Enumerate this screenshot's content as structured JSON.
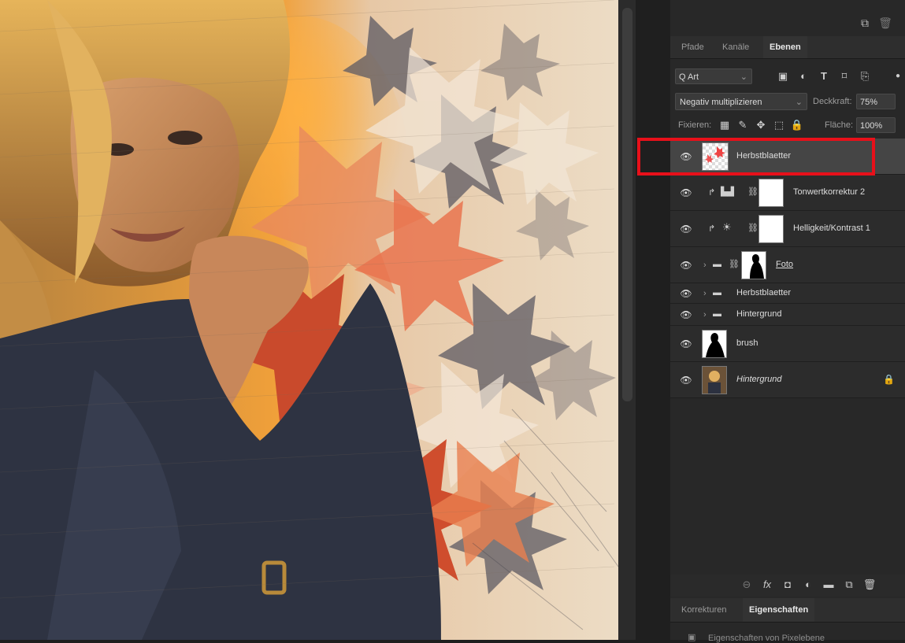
{
  "panel": {
    "tabs": [
      {
        "label": "Pfade",
        "active": false
      },
      {
        "label": "Kanäle",
        "active": false
      },
      {
        "label": "Ebenen",
        "active": true
      }
    ],
    "filter": {
      "search_label": "Q Art",
      "icons": [
        "image-filter-icon",
        "adjustment-filter-icon",
        "type-filter-icon",
        "shape-filter-icon",
        "smart-object-filter-icon"
      ]
    },
    "blend_mode": "Negativ multiplizieren",
    "opacity_label": "Deckkraft:",
    "opacity_value": "75%",
    "lock_label": "Fixieren:",
    "fill_label": "Fläche:",
    "fill_value": "100%",
    "layers": [
      {
        "name": "Herbstblaetter",
        "selected": true,
        "type": "pixel"
      },
      {
        "name": "Tonwertkorrektur 2",
        "selected": false,
        "type": "adjustment"
      },
      {
        "name": "Helligkeit/Kontrast 1",
        "selected": false,
        "type": "adjustment"
      },
      {
        "name": "Foto",
        "selected": false,
        "type": "group-masked"
      },
      {
        "name": "Herbstblaetter",
        "selected": false,
        "type": "group"
      },
      {
        "name": "Hintergrund",
        "selected": false,
        "type": "group"
      },
      {
        "name": "brush",
        "selected": false,
        "type": "pixel"
      },
      {
        "name": "Hintergrund",
        "selected": false,
        "type": "background",
        "locked": true
      }
    ],
    "bottom_tabs": [
      {
        "label": "Korrekturen",
        "active": false
      },
      {
        "label": "Eigenschaften",
        "active": true
      }
    ],
    "properties_text": "Eigenschaften von Pixelebene"
  },
  "colors": {
    "highlight": "#e8101a",
    "panel_bg": "#282828",
    "selected_layer": "#454545"
  }
}
